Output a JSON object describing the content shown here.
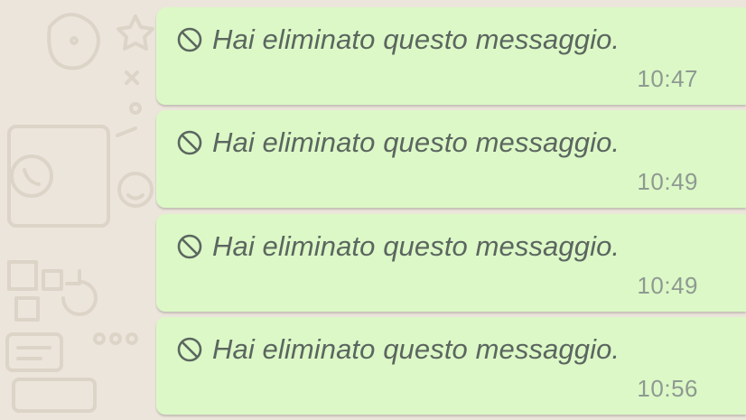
{
  "chat": {
    "wallpaper_color": "#ece5dc",
    "bubble_color": "#dcf8c6",
    "messages": [
      {
        "icon": "ban-icon",
        "text": "Hai eliminato questo messaggio.",
        "time": "10:47"
      },
      {
        "icon": "ban-icon",
        "text": "Hai eliminato questo messaggio.",
        "time": "10:49"
      },
      {
        "icon": "ban-icon",
        "text": "Hai eliminato questo messaggio.",
        "time": "10:49"
      },
      {
        "icon": "ban-icon",
        "text": "Hai eliminato questo messaggio.",
        "time": "10:56"
      }
    ]
  }
}
